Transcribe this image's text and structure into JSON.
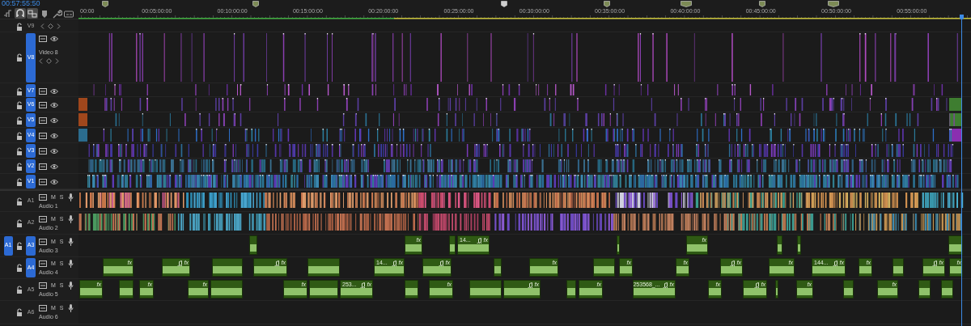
{
  "timecode": "00:57:55:50",
  "toolbar": [
    {
      "kind": "nest",
      "on": false
    },
    {
      "kind": "snap",
      "on": true
    },
    {
      "kind": "linked",
      "on": true
    },
    {
      "kind": "marker",
      "on": false
    },
    {
      "kind": "wrench",
      "on": false
    },
    {
      "kind": "captions",
      "on": false
    }
  ],
  "ruler": {
    "ticks": [
      "00:00",
      "00:05:00:00",
      "00:10:00:00",
      "00:15:00:00",
      "00:20:00:00",
      "00:25:00:00",
      "00:30:00:00",
      "00:35:00:00",
      "00:40:00:00",
      "00:45:00:00",
      "00:50:00:00",
      "00:55:00:00"
    ]
  },
  "video_tracks": [
    {
      "label": "V9",
      "kind": "minimized",
      "targeted": false
    },
    {
      "label": "V8",
      "kind": "expanded",
      "name": "Video 8",
      "targeted": true
    },
    {
      "label": "V7",
      "kind": "normal",
      "targeted": true
    },
    {
      "label": "V6",
      "kind": "normal",
      "targeted": true
    },
    {
      "label": "V5",
      "kind": "normal",
      "targeted": true
    },
    {
      "label": "V4",
      "kind": "normal",
      "targeted": true
    },
    {
      "label": "V3",
      "kind": "normal",
      "targeted": true
    },
    {
      "label": "V2",
      "kind": "normal",
      "targeted": true
    },
    {
      "label": "V1",
      "kind": "normal",
      "targeted": true
    }
  ],
  "audio_tracks": [
    {
      "label": "A1",
      "name": "Audio 1",
      "mute": "M",
      "solo": "S",
      "targeted": false
    },
    {
      "label": "A2",
      "name": "Audio 2",
      "mute": "M",
      "solo": "S",
      "targeted": false
    },
    {
      "label": "A3",
      "name": "Audio 3",
      "mute": "M",
      "solo": "S",
      "targeted": true,
      "source_patch": "A1",
      "clips": [
        {
          "music": false
        },
        {
          "music": false,
          "badge": "fx"
        },
        {
          "music": false
        },
        {
          "music": true,
          "badge": "fx",
          "label": "14..."
        },
        {
          "music": false
        },
        {
          "music": false,
          "badge": "fx"
        },
        {
          "music": false
        },
        {
          "music": false
        },
        {
          "music": false
        }
      ]
    },
    {
      "label": "A4",
      "name": "Audio 4",
      "mute": "M",
      "solo": "S",
      "targeted": true,
      "clips": [
        {
          "music": false,
          "badge": "fx"
        },
        {
          "music": true,
          "badge": "fx"
        },
        {
          "music": false
        },
        {
          "music": true,
          "badge": "fx"
        },
        {
          "music": false
        },
        {
          "music": true,
          "badge": "fx",
          "label": "14..."
        },
        {
          "music": true,
          "badge": "fx"
        },
        {
          "music": false
        },
        {
          "music": false,
          "badge": "fx"
        },
        {
          "music": false
        },
        {
          "music": false,
          "badge": "fx"
        },
        {
          "music": false,
          "badge": "fx"
        },
        {
          "music": true,
          "badge": "fx"
        },
        {
          "music": false,
          "badge": "fx"
        },
        {
          "music": true,
          "badge": "fx",
          "label": "144..."
        },
        {
          "music": false,
          "badge": "fx"
        },
        {
          "music": false
        },
        {
          "music": true,
          "badge": "fx"
        },
        {
          "music": false,
          "badge": "fx"
        }
      ]
    },
    {
      "label": "A5",
      "name": "Audio 5",
      "mute": "M",
      "solo": "S",
      "targeted": false,
      "clips": [
        {
          "music": false,
          "badge": "fx"
        },
        {
          "music": false
        },
        {
          "music": false,
          "badge": "fx"
        },
        {
          "music": false,
          "badge": "fx"
        },
        {
          "music": false
        },
        {
          "music": false,
          "badge": "fx"
        },
        {
          "music": false
        },
        {
          "music": true,
          "badge": "fx",
          "label": "253..."
        },
        {
          "music": false
        },
        {
          "music": false,
          "badge": "fx"
        },
        {
          "music": false
        },
        {
          "music": true,
          "badge": "fx"
        },
        {
          "music": false
        },
        {
          "music": false,
          "badge": "fx"
        },
        {
          "music": true,
          "badge": "fx",
          "label": "253568_..."
        },
        {
          "music": false,
          "badge": "fx"
        },
        {
          "music": true,
          "badge": "fx"
        },
        {
          "music": false
        },
        {
          "music": false,
          "badge": "fx"
        },
        {
          "music": false
        },
        {
          "music": false,
          "badge": "fx"
        },
        {
          "music": false
        },
        {
          "music": false
        }
      ]
    },
    {
      "label": "A6",
      "name": "Audio 6",
      "mute": "M",
      "solo": "S",
      "targeted": false
    }
  ]
}
